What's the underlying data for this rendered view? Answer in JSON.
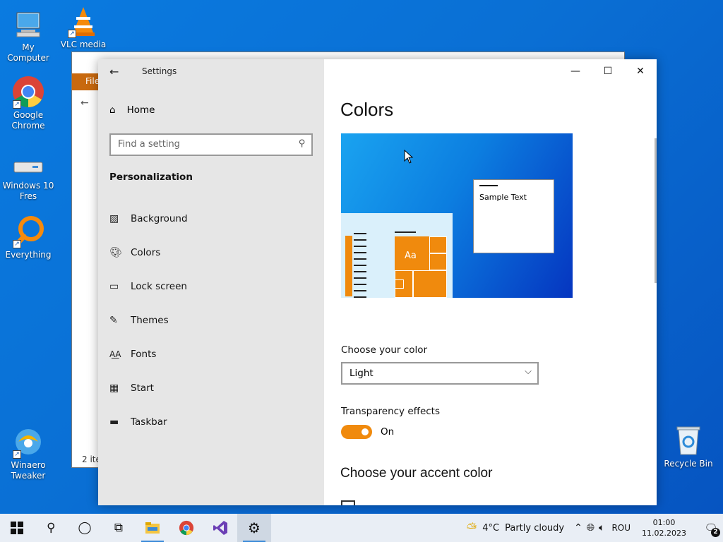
{
  "desktop": {
    "icons": [
      {
        "label": "My Computer",
        "icon": "computer-icon"
      },
      {
        "label": "VLC media",
        "icon": "vlc-icon"
      },
      {
        "label": "Google Chrome",
        "icon": "chrome-icon"
      },
      {
        "label": "Windows 10 Fres",
        "icon": "drive-icon"
      },
      {
        "label": "Everything",
        "icon": "everything-icon"
      },
      {
        "label": "Winaero Tweaker",
        "icon": "winaero-icon"
      },
      {
        "label": "Recycle Bin",
        "icon": "recycle-bin-icon"
      }
    ]
  },
  "explorer": {
    "ribbon_tab": "File",
    "status": "2 ite"
  },
  "settings": {
    "app_title": "Settings",
    "home": "Home",
    "search_placeholder": "Find a setting",
    "section": "Personalization",
    "nav_items": [
      {
        "label": "Background",
        "icon": "image-icon"
      },
      {
        "label": "Colors",
        "icon": "palette-icon"
      },
      {
        "label": "Lock screen",
        "icon": "lock-screen-icon"
      },
      {
        "label": "Themes",
        "icon": "themes-icon"
      },
      {
        "label": "Fonts",
        "icon": "fonts-icon"
      },
      {
        "label": "Start",
        "icon": "start-icon"
      },
      {
        "label": "Taskbar",
        "icon": "taskbar-icon"
      }
    ],
    "page_title": "Colors",
    "preview_sample_text": "Sample Text",
    "preview_tile_text": "Aa",
    "choose_color_label": "Choose your color",
    "choose_color_value": "Light",
    "transparency_label": "Transparency effects",
    "transparency_state": "On",
    "accent_heading": "Choose your accent color",
    "accent_color": "#f08a0d"
  },
  "taskbar": {
    "weather_temp": "4°C",
    "weather_text": "Partly cloudy",
    "language": "ROU",
    "time": "01:00",
    "date": "11.02.2023",
    "notifications": "2"
  }
}
